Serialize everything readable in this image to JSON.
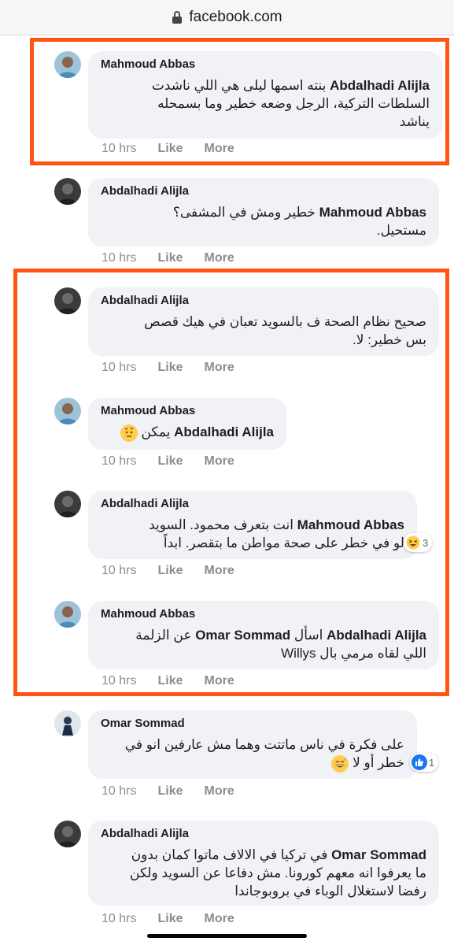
{
  "browser": {
    "url": "facebook.com"
  },
  "comments": [
    {
      "author": "Mahmoud Abbas",
      "mention": "Abdalhadi Alijla",
      "lines": [
        "بنته اسمها ليلى هي اللي ناشدت",
        "السلطات التركية، الرجل وضعه خطير وما بسمحله",
        "يناشد"
      ],
      "time": "10 hrs",
      "like": "Like",
      "more": "More"
    },
    {
      "author": "Abdalhadi Alijla",
      "mention": "Mahmoud Abbas",
      "lines": [
        "خطير ومش في المشفى؟",
        "مستحيل."
      ],
      "time": "10 hrs",
      "like": "Like",
      "more": "More"
    },
    {
      "author": "Abdalhadi Alijla",
      "mention": "",
      "lines": [
        "صحيح نظام الصحة ف بالسويد تعبان في هيك قصص",
        "بس خطير: لا."
      ],
      "time": "10 hrs",
      "like": "Like",
      "more": "More"
    },
    {
      "author": "Mahmoud Abbas",
      "mention": "Abdalhadi Alijla",
      "lines": [
        "يمكن"
      ],
      "emoji": "face-with-raised-eyebrow",
      "time": "10 hrs",
      "like": "Like",
      "more": "More"
    },
    {
      "author": "Abdalhadi Alijla",
      "mention": "Mahmoud Abbas",
      "lines": [
        "انت بتعرف محمود. السويد",
        "لو في خطر على صحة مواطن ما بتقصر. ابداً"
      ],
      "reaction": {
        "icon": "haha-icon",
        "count": "3"
      },
      "time": "10 hrs",
      "like": "Like",
      "more": "More"
    },
    {
      "author": "Mahmoud Abbas",
      "mention": "Abdalhadi Alijla",
      "mention2": "Omar Sommad",
      "lines": [
        "اسأل",
        "عن الزلمة",
        "اللي لقاه مرمي بال Willys"
      ],
      "time": "10 hrs",
      "like": "Like",
      "more": "More"
    },
    {
      "author": "Omar Sommad",
      "mention": "",
      "lines": [
        "على فكرة في ناس ماتتت وهما مش عارفين انو في",
        "خطر أو لا"
      ],
      "emoji": "grinning-sweat",
      "reaction": {
        "icon": "like-icon",
        "count": "1"
      },
      "time": "10 hrs",
      "like": "Like",
      "more": "More"
    },
    {
      "author": "Abdalhadi Alijla",
      "mention": "Omar Sommad",
      "lines": [
        "في تركيا في الالاف ماتوا كمان بدون",
        "ما يعرفوا انه معهم كورونا. مش دفاعا عن السويد ولكن",
        "رفضا لاستغلال الوباء في بروبوجاندا"
      ],
      "time": "10 hrs",
      "like": "Like",
      "more": "More"
    }
  ],
  "colors": {
    "highlight": "#ff5513",
    "bubble": "#f0f2f5",
    "meta": "#8a8d91"
  }
}
